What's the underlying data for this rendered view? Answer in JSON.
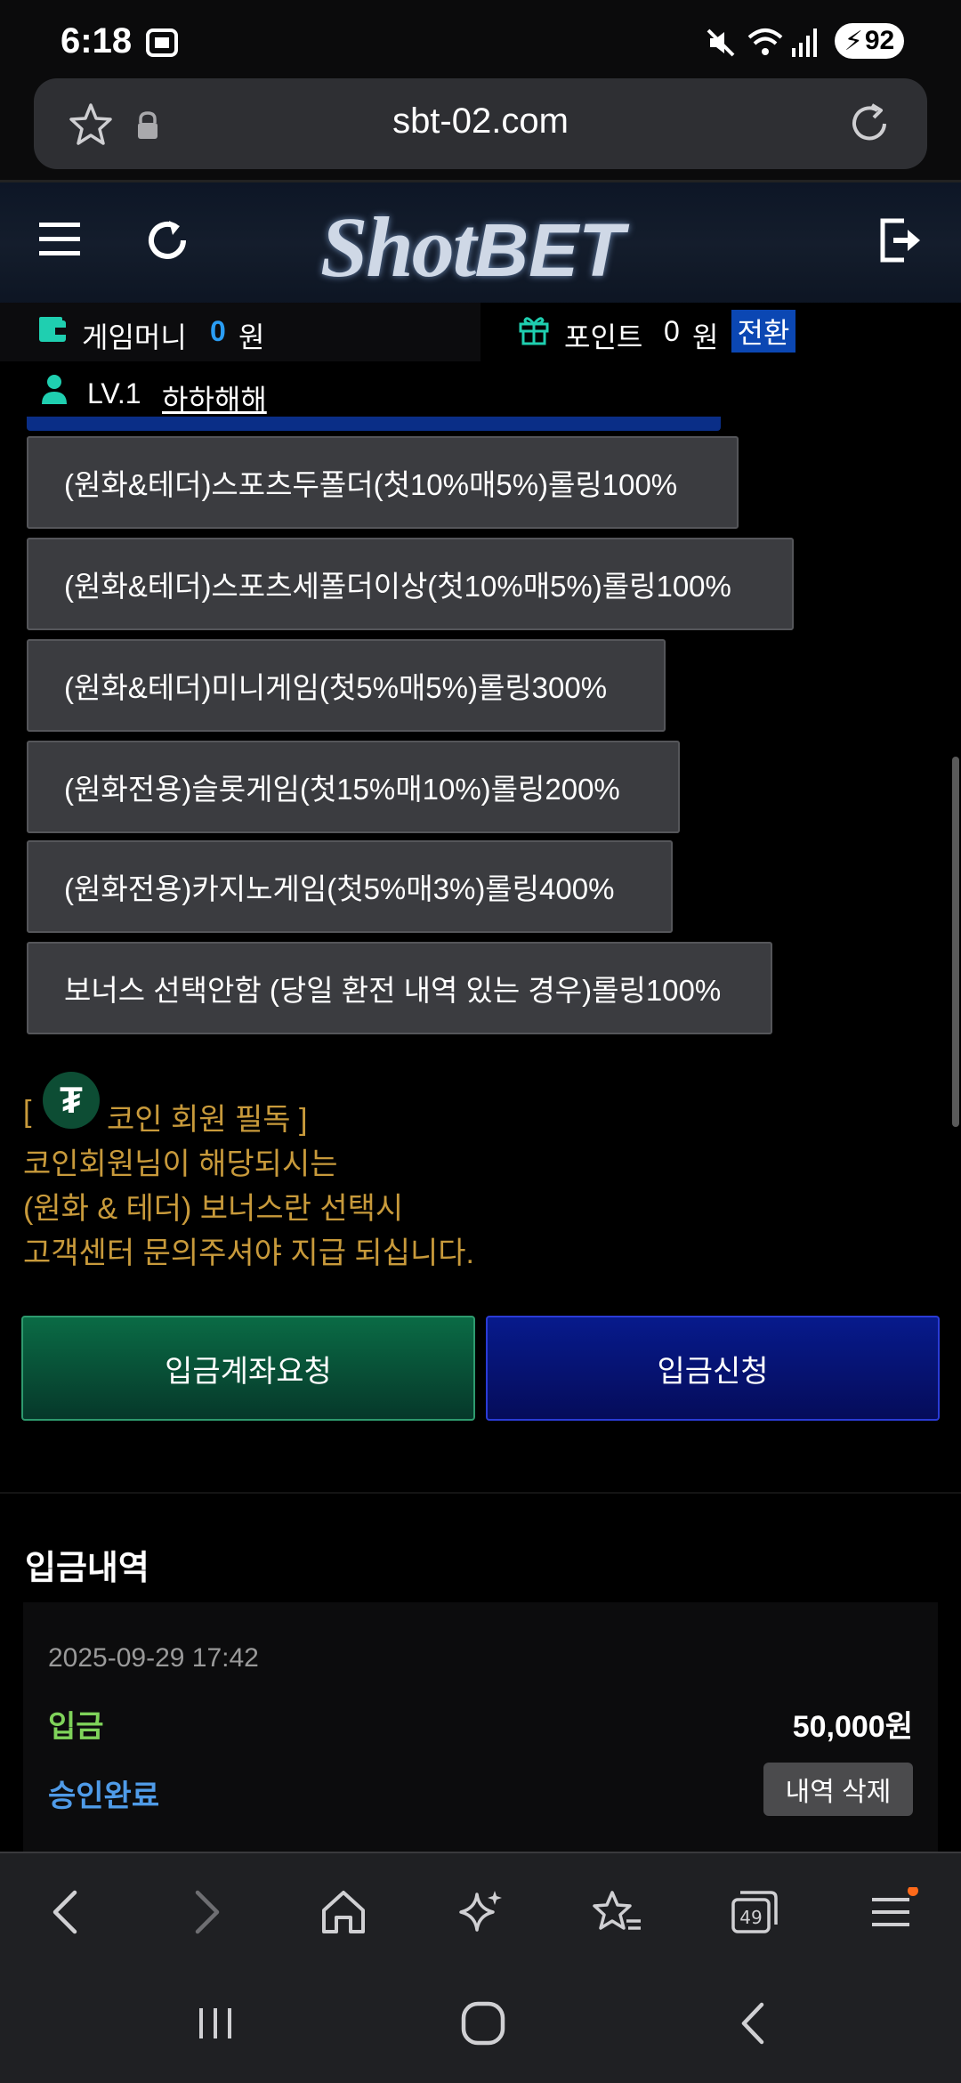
{
  "status_bar": {
    "time": "6:18",
    "battery": "92"
  },
  "browser": {
    "url": "sbt-02.com"
  },
  "site": {
    "logo_shot": "Shot",
    "logo_bet": "BET",
    "game_money_label": "게임머니",
    "game_money_value": "0",
    "game_money_unit": "원",
    "point_label": "포인트",
    "point_value": "0",
    "point_unit": "원",
    "convert_label": "전환",
    "level": "LV.1",
    "username": "하하해해"
  },
  "bonus_options": [
    "(원화&테더)스포츠두폴더(첫10%매5%)롤링100%",
    "(원화&테더)스포츠세폴더이상(첫10%매5%)롤링100%",
    "(원화&테더)미니게임(첫5%매5%)롤링300%",
    "(원화전용)슬롯게임(첫15%매10%)롤링200%",
    "(원화전용)카지노게임(첫5%매3%)롤링400%",
    "보너스 선택안함 (당일 환전 내역 있는 경우)롤링100%"
  ],
  "notice": {
    "bracket_open": "[",
    "title": "코인 회원 필독 ]",
    "line1": "코인회원님이 해당되시는",
    "line2": "(원화 & 테더) 보너스란 선택시",
    "line3": "고객센터 문의주셔야 지급 되십니다."
  },
  "actions": {
    "request_account": "입금계좌요청",
    "deposit_request": "입금신청"
  },
  "history": {
    "title": "입금내역",
    "items": [
      {
        "date": "2025-09-29 17:42",
        "type": "입금",
        "amount": "50,000원",
        "status": "승인완료",
        "delete_label": "내역 삭제"
      }
    ]
  },
  "toolbar": {
    "tabs_count": "49"
  },
  "colors": {
    "accent_blue": "#2a9df4",
    "notice_gold": "#c89a3b",
    "deposit_green": "#7fd35a",
    "status_blue": "#4f9be8"
  }
}
